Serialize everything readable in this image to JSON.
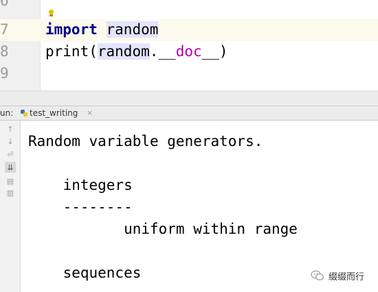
{
  "editor": {
    "lines": [
      {
        "number": "6",
        "code": ""
      },
      {
        "number": "7",
        "kw": "import",
        "module": "random"
      },
      {
        "number": "8",
        "fn": "print",
        "open": "(",
        "obj": "random",
        "dot": ".",
        "us1": "__",
        "name": "doc",
        "us2": "__",
        "close": ")"
      },
      {
        "number": "9",
        "code": ""
      }
    ],
    "intention_icon": "lightbulb-icon"
  },
  "run_panel": {
    "label": "un:",
    "tab_label": "test_writing",
    "tab_close": "×",
    "tab_icon": "python-file-icon",
    "toolbar": [
      {
        "icon": "arrow-up-icon",
        "glyph": "↑"
      },
      {
        "icon": "arrow-down-icon",
        "glyph": "↓"
      },
      {
        "icon": "soft-wrap-icon",
        "glyph": "⏎"
      },
      {
        "icon": "scroll-to-end-icon",
        "glyph": "⇊"
      },
      {
        "icon": "print-icon",
        "glyph": "▤"
      },
      {
        "icon": "trash-icon",
        "glyph": "▥"
      }
    ],
    "output": [
      "Random variable generators.",
      "",
      "    integers",
      "    --------",
      "           uniform within range",
      "",
      "    sequences"
    ]
  },
  "watermark": {
    "text": "缀缀而行",
    "icon": "wechat-icon"
  },
  "colors": {
    "keyword": "#000080",
    "dunder": "#b200b2",
    "current_line": "#fcfaed",
    "selection": "#e4e4ff"
  }
}
